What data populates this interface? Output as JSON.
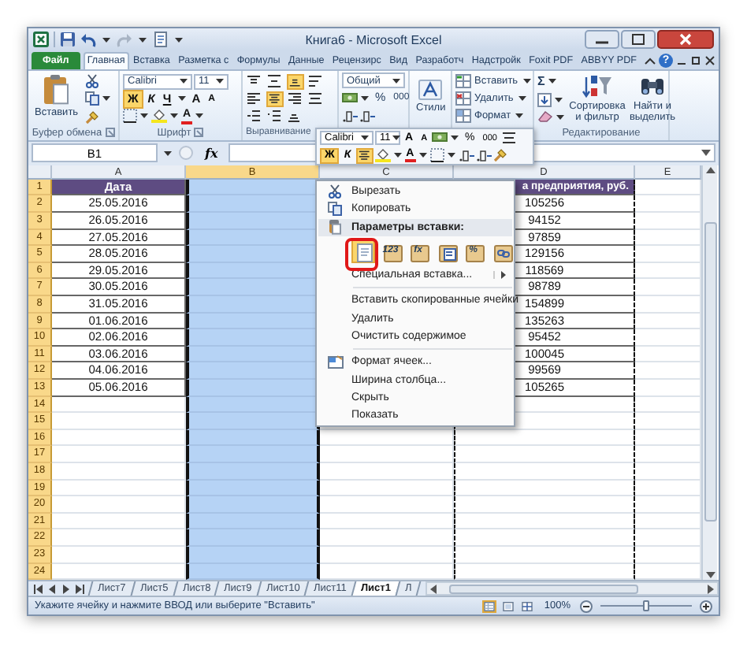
{
  "window": {
    "title": "Книга6 - Microsoft Excel"
  },
  "ribbon_tabs": [
    {
      "label": "Файл",
      "kind": "file",
      "selected": false
    },
    {
      "label": "Главная",
      "kind": "tab",
      "selected": true
    },
    {
      "label": "Вставка",
      "kind": "tab",
      "selected": false
    },
    {
      "label": "Разметка с",
      "kind": "tab",
      "selected": false
    },
    {
      "label": "Формулы",
      "kind": "tab",
      "selected": false
    },
    {
      "label": "Данные",
      "kind": "tab",
      "selected": false
    },
    {
      "label": "Рецензирс",
      "kind": "tab",
      "selected": false
    },
    {
      "label": "Вид",
      "kind": "tab",
      "selected": false
    },
    {
      "label": "Разработч",
      "kind": "tab",
      "selected": false
    },
    {
      "label": "Надстройк",
      "kind": "tab",
      "selected": false
    },
    {
      "label": "Foxit PDF",
      "kind": "tab",
      "selected": false
    },
    {
      "label": "ABBYY PDF",
      "kind": "tab",
      "selected": false
    }
  ],
  "help": "?",
  "clipboard": {
    "paste": "Вставить",
    "label": "Буфер обмена"
  },
  "font": {
    "name": "Calibri",
    "size": "11",
    "grow": "A",
    "shrink": "A",
    "color_button": "A",
    "label": "Шрифт",
    "styles": [
      {
        "label": "Ж",
        "kind": "bold",
        "on": true
      },
      {
        "label": "К",
        "kind": "italic",
        "on": false
      },
      {
        "label": "Ч",
        "kind": "underline",
        "on": false
      }
    ]
  },
  "alignment": {
    "label": "Выравнивание",
    "buttons": [
      {
        "kind": "top",
        "on": false
      },
      {
        "kind": "middle",
        "on": false
      },
      {
        "kind": "bottom",
        "on": true
      },
      {
        "kind": "wrap",
        "on": false
      },
      {
        "kind": "left",
        "on": false
      },
      {
        "kind": "center",
        "on": true
      },
      {
        "kind": "right",
        "on": false
      },
      {
        "kind": "merge",
        "on": false
      },
      {
        "kind": "outdent",
        "on": false
      },
      {
        "kind": "indent",
        "on": false
      },
      {
        "kind": "orientation",
        "on": false
      }
    ]
  },
  "number": {
    "format": "Общий",
    "percent": "%",
    "thousands": "000"
  },
  "styles": {
    "label": "Стили"
  },
  "cells": {
    "insert": "Вставить",
    "delete": "Удалить",
    "format": "Формат"
  },
  "editing": {
    "sum": "Σ",
    "sort": "Сортировка и фильтр",
    "find": "Найти и выделить",
    "label": "Редактирование"
  },
  "name_box": "B1",
  "formula_icon": "fx",
  "mini_toolbar": {
    "font": "Calibri",
    "size": "11",
    "grow": "A",
    "shrink": "A",
    "percent": "%",
    "thousands": "000",
    "color_button": "A",
    "styles": [
      {
        "label": "Ж",
        "kind": "bold",
        "on": true
      },
      {
        "label": "К",
        "kind": "italic",
        "on": false
      }
    ],
    "center_on": true
  },
  "columns": [
    {
      "label": "A",
      "selected": false,
      "copied": false
    },
    {
      "label": "B",
      "selected": true,
      "copied": false
    },
    {
      "label": "C",
      "selected": false,
      "copied": false
    },
    {
      "label": "D",
      "selected": false,
      "copied": true
    },
    {
      "label": "E",
      "selected": false,
      "copied": false
    }
  ],
  "rows": [
    {
      "number": "1",
      "kind": "header",
      "date": "Дата",
      "revenue": "а предприятия, руб."
    },
    {
      "number": "2",
      "kind": "data",
      "date": "25.05.2016",
      "revenue": "105256"
    },
    {
      "number": "3",
      "kind": "data",
      "date": "26.05.2016",
      "revenue": "94152"
    },
    {
      "number": "4",
      "kind": "data",
      "date": "27.05.2016",
      "revenue": "97859"
    },
    {
      "number": "5",
      "kind": "data",
      "date": "28.05.2016",
      "revenue": "129156"
    },
    {
      "number": "6",
      "kind": "data",
      "date": "29.05.2016",
      "revenue": "118569"
    },
    {
      "number": "7",
      "kind": "data",
      "date": "30.05.2016",
      "revenue": "98789"
    },
    {
      "number": "8",
      "kind": "data",
      "date": "31.05.2016",
      "revenue": "154899"
    },
    {
      "number": "9",
      "kind": "data",
      "date": "01.06.2016",
      "revenue": "135263"
    },
    {
      "number": "10",
      "kind": "data",
      "date": "02.06.2016",
      "revenue": "95452"
    },
    {
      "number": "11",
      "kind": "data",
      "date": "03.06.2016",
      "revenue": "100045"
    },
    {
      "number": "12",
      "kind": "data",
      "date": "04.06.2016",
      "revenue": "99569"
    },
    {
      "number": "13",
      "kind": "data",
      "date": "05.06.2016",
      "revenue": "105265"
    },
    {
      "number": "14",
      "kind": "empty"
    },
    {
      "number": "15",
      "kind": "empty"
    },
    {
      "number": "16",
      "kind": "empty"
    },
    {
      "number": "17",
      "kind": "empty"
    },
    {
      "number": "18",
      "kind": "empty"
    },
    {
      "number": "19",
      "kind": "empty"
    },
    {
      "number": "20",
      "kind": "empty"
    },
    {
      "number": "21",
      "kind": "empty"
    },
    {
      "number": "22",
      "kind": "empty"
    },
    {
      "number": "23",
      "kind": "empty"
    },
    {
      "number": "24",
      "kind": "empty"
    }
  ],
  "context_menu": {
    "items": [
      {
        "kind": "cut",
        "label": "Вырезать"
      },
      {
        "kind": "copy",
        "label": "Копировать"
      },
      {
        "kind": "heading",
        "label": "Параметры вставки:"
      },
      {
        "kind": "paste_options",
        "options": [
          {
            "kind": "paste",
            "selected": true,
            "callout": true
          },
          {
            "kind": "values",
            "glyph": "123",
            "selected": false,
            "callout": false
          },
          {
            "kind": "formulas",
            "glyph": "fx",
            "selected": false,
            "callout": false
          },
          {
            "kind": "transpose",
            "selected": false,
            "callout": false
          },
          {
            "kind": "formatting",
            "glyph": "%",
            "selected": false,
            "callout": false
          },
          {
            "kind": "link",
            "selected": false,
            "callout": false
          }
        ]
      },
      {
        "kind": "submenu",
        "label": "Специальная вставка..."
      },
      {
        "kind": "separator"
      },
      {
        "kind": "item",
        "label": "Вставить скопированные ячейки"
      },
      {
        "kind": "item",
        "label": "Удалить"
      },
      {
        "kind": "item",
        "label": "Очистить содержимое"
      },
      {
        "kind": "separator"
      },
      {
        "kind": "format",
        "label": "Формат ячеек..."
      },
      {
        "kind": "item",
        "label": "Ширина столбца..."
      },
      {
        "kind": "item",
        "label": "Скрыть"
      },
      {
        "kind": "item",
        "label": "Показать"
      }
    ]
  },
  "sheet_tabs": [
    {
      "label": "Лист7",
      "selected": false
    },
    {
      "label": "Лист5",
      "selected": false
    },
    {
      "label": "Лист8",
      "selected": false
    },
    {
      "label": "Лист9",
      "selected": false
    },
    {
      "label": "Лист10",
      "selected": false
    },
    {
      "label": "Лист11",
      "selected": false
    },
    {
      "label": "Лист1",
      "selected": true
    },
    {
      "label": "Л",
      "selected": false
    }
  ],
  "status_bar": {
    "message": "Укажите ячейку и нажмите ВВОД или выберите \"Вставить\"",
    "views": [
      {
        "kind": "normal",
        "selected": true
      },
      {
        "kind": "layout",
        "selected": false
      },
      {
        "kind": "page_break",
        "selected": false
      }
    ],
    "zoom": "100%",
    "zoom_slider": {
      "level": 0.5
    }
  }
}
